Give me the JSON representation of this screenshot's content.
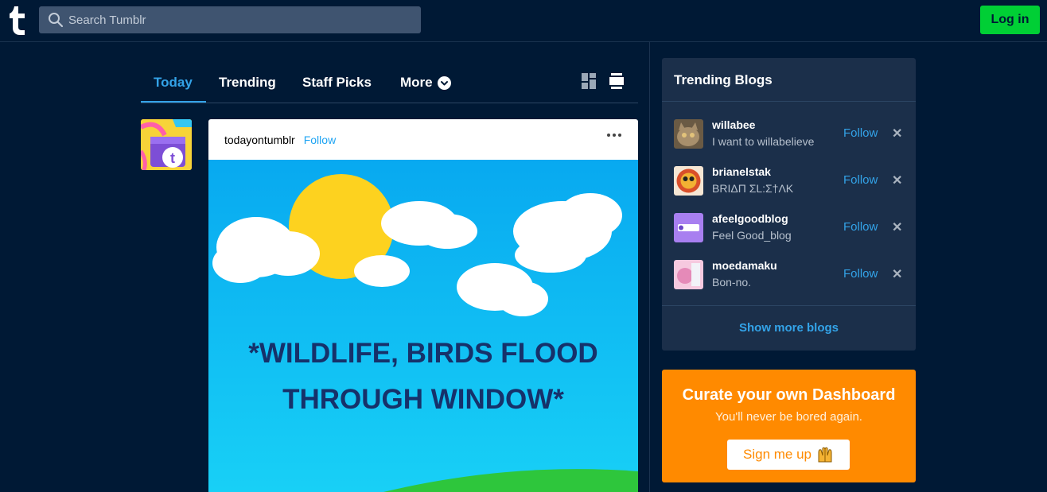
{
  "header": {
    "search_placeholder": "Search Tumblr",
    "login_label": "Log in"
  },
  "tabs": [
    {
      "label": "Today",
      "active": true
    },
    {
      "label": "Trending",
      "active": false
    },
    {
      "label": "Staff Picks",
      "active": false
    },
    {
      "label": "More",
      "active": false
    }
  ],
  "post": {
    "blog_name": "todayontumblr",
    "follow_label": "Follow",
    "image_text_line1": "*WILDLIFE, BIRDS FLOOD",
    "image_text_line2": "THROUGH WINDOW*"
  },
  "trending": {
    "title": "Trending Blogs",
    "blogs": [
      {
        "name": "willabee",
        "description": "I want to willabelieve",
        "follow": "Follow"
      },
      {
        "name": "brianelstak",
        "description": "BRIΔΠ ΣL:Σ†ΛK",
        "follow": "Follow"
      },
      {
        "name": "afeelgoodblog",
        "description": "Feel Good_blog",
        "follow": "Follow"
      },
      {
        "name": "moedamaku",
        "description": "Bon-no.",
        "follow": "Follow"
      }
    ],
    "show_more": "Show more blogs"
  },
  "curate": {
    "title": "Curate your own Dashboard",
    "subtitle": "You'll never be bored again.",
    "button_label": "Sign me up"
  },
  "colors": {
    "background": "#001935",
    "accent_blue": "#33a3e8",
    "login_green": "#00cf35",
    "curate_orange": "#ff8a00",
    "panel": "#1b2f4a"
  }
}
